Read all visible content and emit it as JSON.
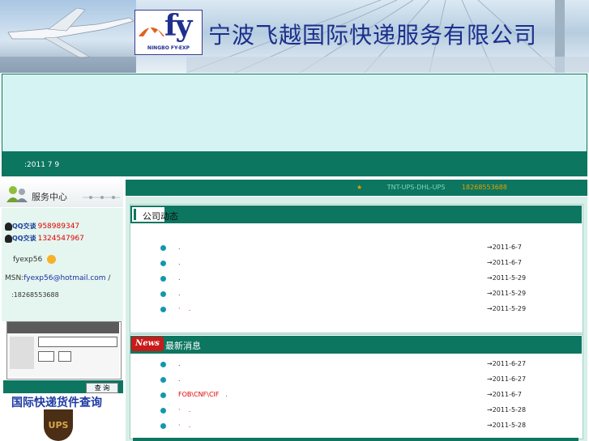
{
  "header": {
    "logo_text": "fy",
    "logo_sub": "NINGBO FY-EXP",
    "company_name": "宁波飞越国际快递服务有限公司"
  },
  "notice": {
    "text": ":2011 7 9"
  },
  "left": {
    "service_title": "服务中心",
    "qq": [
      {
        "badge": "QQ交谈",
        "number": "958989347"
      },
      {
        "badge": "QQ交谈",
        "number": "1324547967"
      }
    ],
    "name": "fyexp56",
    "msn_label": "MSN:",
    "msn_value": "fyexp56@hotmail.com",
    "msn_suffix": " /",
    "phone": ":18268553688",
    "search_button": "查 询",
    "track_title": "国际快递货件查询",
    "ups_logo": "UPS"
  },
  "marquee": {
    "star": "★",
    "text": "TNT-UPS-DHL-UPS",
    "phone": "18268553688"
  },
  "company_news": {
    "title": "公司动态",
    "items": [
      {
        "title": ".",
        "date": "→2011-6-7",
        "red": false
      },
      {
        "title": ".",
        "date": "→2011-6-7",
        "red": false
      },
      {
        "title": ".",
        "date": "→2011-5-29",
        "red": false
      },
      {
        "title": ".",
        "date": "→2011-5-29",
        "red": false
      },
      {
        "title": "·    .",
        "date": "→2011-5-29",
        "red": true
      }
    ]
  },
  "latest_news": {
    "badge": "News",
    "title": "最新消息",
    "items": [
      {
        "title": ".",
        "date": "→2011-6-27",
        "red": false
      },
      {
        "title": ".",
        "date": "→2011-6-27",
        "red": false
      },
      {
        "title": "FOB\\CNF\\CIF   .",
        "date": "→2011-6-7",
        "red": true
      },
      {
        "title": "·    .",
        "date": "→2011-5-28",
        "red": true
      },
      {
        "title": "·    .",
        "date": "→2011-5-28",
        "red": true
      }
    ]
  },
  "colors": {
    "brand_green": "#0c7660",
    "banner_bg": "#d6f3f3",
    "title_blue": "#1c2f8c"
  }
}
